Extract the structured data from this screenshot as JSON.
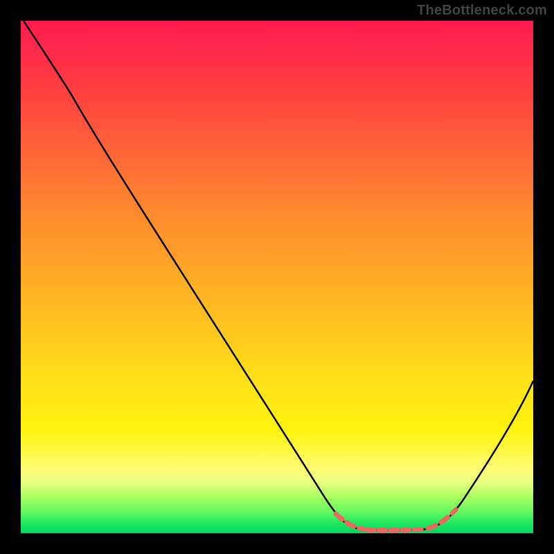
{
  "watermark": "TheBottleneck.com",
  "chart_data": {
    "type": "line",
    "title": "",
    "xlabel": "",
    "ylabel": "",
    "xlim": [
      0,
      100
    ],
    "ylim": [
      0,
      100
    ],
    "x": [
      0,
      5,
      10,
      15,
      20,
      25,
      30,
      35,
      40,
      45,
      50,
      55,
      60,
      64,
      68,
      72,
      76,
      80,
      84,
      88,
      92,
      96,
      100
    ],
    "values": [
      100,
      96,
      91,
      84,
      76,
      68,
      60,
      52,
      44,
      36,
      28,
      20,
      12,
      6,
      2,
      0,
      0,
      0,
      0,
      2,
      8,
      18,
      30
    ],
    "gradient_stops": [
      {
        "pct": 0,
        "color": "#ff1a4d"
      },
      {
        "pct": 50,
        "color": "#ffb020"
      },
      {
        "pct": 85,
        "color": "#fff40e"
      },
      {
        "pct": 100,
        "color": "#00d860"
      }
    ],
    "highlight_range_x": [
      68,
      84
    ],
    "highlight_color": "#e86a60"
  }
}
